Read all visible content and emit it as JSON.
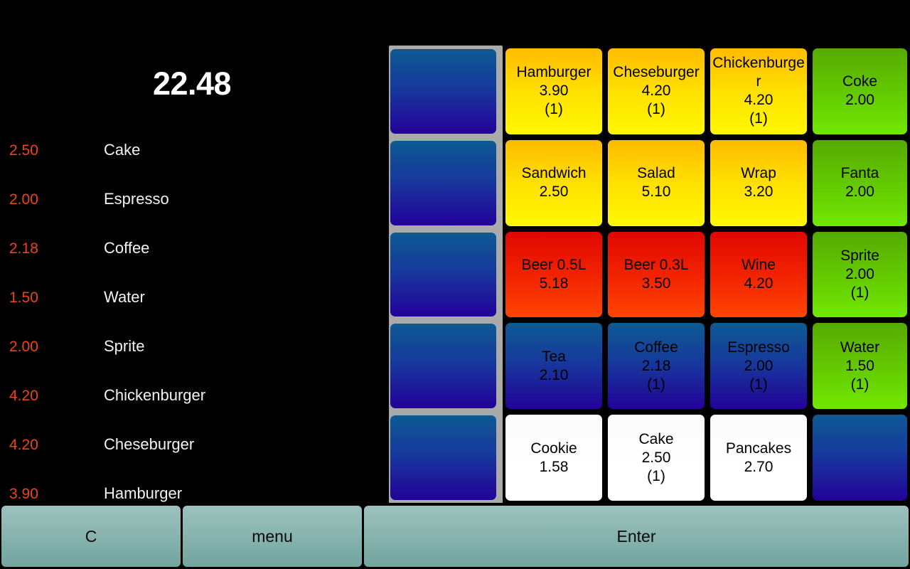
{
  "total": {
    "label": "22.48"
  },
  "receipt": {
    "items": [
      {
        "price": "2.50",
        "name": "Cake"
      },
      {
        "price": "2.00",
        "name": "Espresso"
      },
      {
        "price": "2.18",
        "name": "Coffee"
      },
      {
        "price": "1.50",
        "name": "Water"
      },
      {
        "price": "2.00",
        "name": "Sprite"
      },
      {
        "price": "4.20",
        "name": "Chickenburger"
      },
      {
        "price": "4.20",
        "name": "Cheseburger"
      },
      {
        "price": "3.90",
        "name": "Hamburger"
      }
    ]
  },
  "colors": {
    "price_text": "#ee4411",
    "item_text": "#f2f2f2",
    "total_text": "#ffffff",
    "background": "#000000",
    "frame": "#aaaaaa",
    "toolbar_button": "#8ab5b0",
    "yellow_button": "#ffe000",
    "green_button": "#63c800",
    "red_button": "#f22200",
    "blue_button": "#163a9c",
    "white_button": "#ffffff"
  },
  "keypad": {
    "columns": 5,
    "rows": 5,
    "selected_column": 1,
    "buttons": [
      {
        "row": 1,
        "col": 1,
        "color": "blue",
        "name": "",
        "price": "",
        "qty": ""
      },
      {
        "row": 1,
        "col": 2,
        "color": "yellow",
        "name": "Hamburger",
        "price": "3.90",
        "qty": "(1)"
      },
      {
        "row": 1,
        "col": 3,
        "color": "yellow",
        "name": "Cheseburger",
        "price": "4.20",
        "qty": "(1)"
      },
      {
        "row": 1,
        "col": 4,
        "color": "yellow",
        "name": "Chickenburger",
        "price": "4.20",
        "qty": "(1)"
      },
      {
        "row": 1,
        "col": 5,
        "color": "green",
        "name": "Coke",
        "price": "2.00",
        "qty": ""
      },
      {
        "row": 2,
        "col": 1,
        "color": "blue",
        "name": "",
        "price": "",
        "qty": ""
      },
      {
        "row": 2,
        "col": 2,
        "color": "yellow",
        "name": "Sandwich",
        "price": "2.50",
        "qty": ""
      },
      {
        "row": 2,
        "col": 3,
        "color": "yellow",
        "name": "Salad",
        "price": "5.10",
        "qty": ""
      },
      {
        "row": 2,
        "col": 4,
        "color": "yellow",
        "name": "Wrap",
        "price": "3.20",
        "qty": ""
      },
      {
        "row": 2,
        "col": 5,
        "color": "green",
        "name": "Fanta",
        "price": "2.00",
        "qty": ""
      },
      {
        "row": 3,
        "col": 1,
        "color": "blue",
        "name": "",
        "price": "",
        "qty": ""
      },
      {
        "row": 3,
        "col": 2,
        "color": "red",
        "name": "Beer 0.5L",
        "price": "5.18",
        "qty": ""
      },
      {
        "row": 3,
        "col": 3,
        "color": "red",
        "name": "Beer 0.3L",
        "price": "3.50",
        "qty": ""
      },
      {
        "row": 3,
        "col": 4,
        "color": "red",
        "name": "Wine",
        "price": "4.20",
        "qty": ""
      },
      {
        "row": 3,
        "col": 5,
        "color": "green",
        "name": "Sprite",
        "price": "2.00",
        "qty": "(1)"
      },
      {
        "row": 4,
        "col": 1,
        "color": "blue",
        "name": "",
        "price": "",
        "qty": ""
      },
      {
        "row": 4,
        "col": 2,
        "color": "blue",
        "name": "Tea",
        "price": "2.10",
        "qty": ""
      },
      {
        "row": 4,
        "col": 3,
        "color": "blue",
        "name": "Coffee",
        "price": "2.18",
        "qty": "(1)"
      },
      {
        "row": 4,
        "col": 4,
        "color": "blue",
        "name": "Espresso",
        "price": "2.00",
        "qty": "(1)"
      },
      {
        "row": 4,
        "col": 5,
        "color": "green",
        "name": "Water",
        "price": "1.50",
        "qty": "(1)"
      },
      {
        "row": 5,
        "col": 1,
        "color": "blue",
        "name": "",
        "price": "",
        "qty": ""
      },
      {
        "row": 5,
        "col": 2,
        "color": "white",
        "name": "Cookie",
        "price": "1.58",
        "qty": ""
      },
      {
        "row": 5,
        "col": 3,
        "color": "white",
        "name": "Cake",
        "price": "2.50",
        "qty": "(1)"
      },
      {
        "row": 5,
        "col": 4,
        "color": "white",
        "name": "Pancakes",
        "price": "2.70",
        "qty": ""
      },
      {
        "row": 5,
        "col": 5,
        "color": "blue",
        "name": "",
        "price": "",
        "qty": ""
      }
    ]
  },
  "toolbar": {
    "clear_label": "C",
    "menu_label": "menu",
    "enter_label": "Enter"
  }
}
